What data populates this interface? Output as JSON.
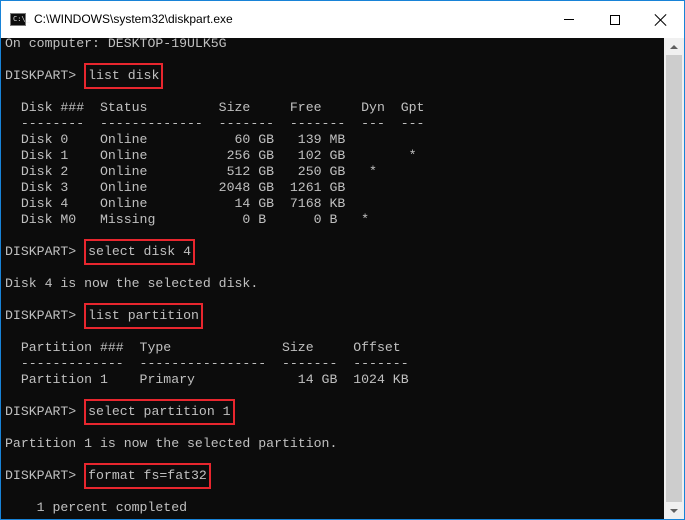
{
  "window": {
    "title": "C:\\WINDOWS\\system32\\diskpart.exe",
    "prompt_glyph": "C:\\_",
    "border_color": "#1883d7",
    "highlight_color": "#e8262e"
  },
  "console": {
    "lines": [
      {
        "type": "text",
        "text": "On computer: DESKTOP-19ULK5G"
      },
      {
        "type": "blank"
      },
      {
        "type": "cmd",
        "prompt": "DISKPART> ",
        "command": "list disk"
      },
      {
        "type": "blank"
      },
      {
        "type": "text",
        "text": "  Disk ###  Status         Size     Free     Dyn  Gpt"
      },
      {
        "type": "text",
        "text": "  --------  -------------  -------  -------  ---  ---"
      },
      {
        "type": "text",
        "text": "  Disk 0    Online           60 GB   139 MB"
      },
      {
        "type": "text",
        "text": "  Disk 1    Online          256 GB   102 GB        *"
      },
      {
        "type": "text",
        "text": "  Disk 2    Online          512 GB   250 GB   *"
      },
      {
        "type": "text",
        "text": "  Disk 3    Online         2048 GB  1261 GB"
      },
      {
        "type": "text",
        "text": "  Disk 4    Online           14 GB  7168 KB"
      },
      {
        "type": "text",
        "text": "  Disk M0   Missing           0 B      0 B   *"
      },
      {
        "type": "blank"
      },
      {
        "type": "cmd",
        "prompt": "DISKPART> ",
        "command": "select disk 4"
      },
      {
        "type": "blank"
      },
      {
        "type": "text",
        "text": "Disk 4 is now the selected disk."
      },
      {
        "type": "blank"
      },
      {
        "type": "cmd",
        "prompt": "DISKPART> ",
        "command": "list partition"
      },
      {
        "type": "blank"
      },
      {
        "type": "text",
        "text": "  Partition ###  Type              Size     Offset"
      },
      {
        "type": "text",
        "text": "  -------------  ----------------  -------  -------"
      },
      {
        "type": "text",
        "text": "  Partition 1    Primary             14 GB  1024 KB"
      },
      {
        "type": "blank"
      },
      {
        "type": "cmd",
        "prompt": "DISKPART> ",
        "command": "select partition 1"
      },
      {
        "type": "blank"
      },
      {
        "type": "text",
        "text": "Partition 1 is now the selected partition."
      },
      {
        "type": "blank"
      },
      {
        "type": "cmd",
        "prompt": "DISKPART> ",
        "command": "format fs=fat32"
      },
      {
        "type": "blank"
      },
      {
        "type": "text",
        "text": "    1 percent completed"
      }
    ]
  }
}
